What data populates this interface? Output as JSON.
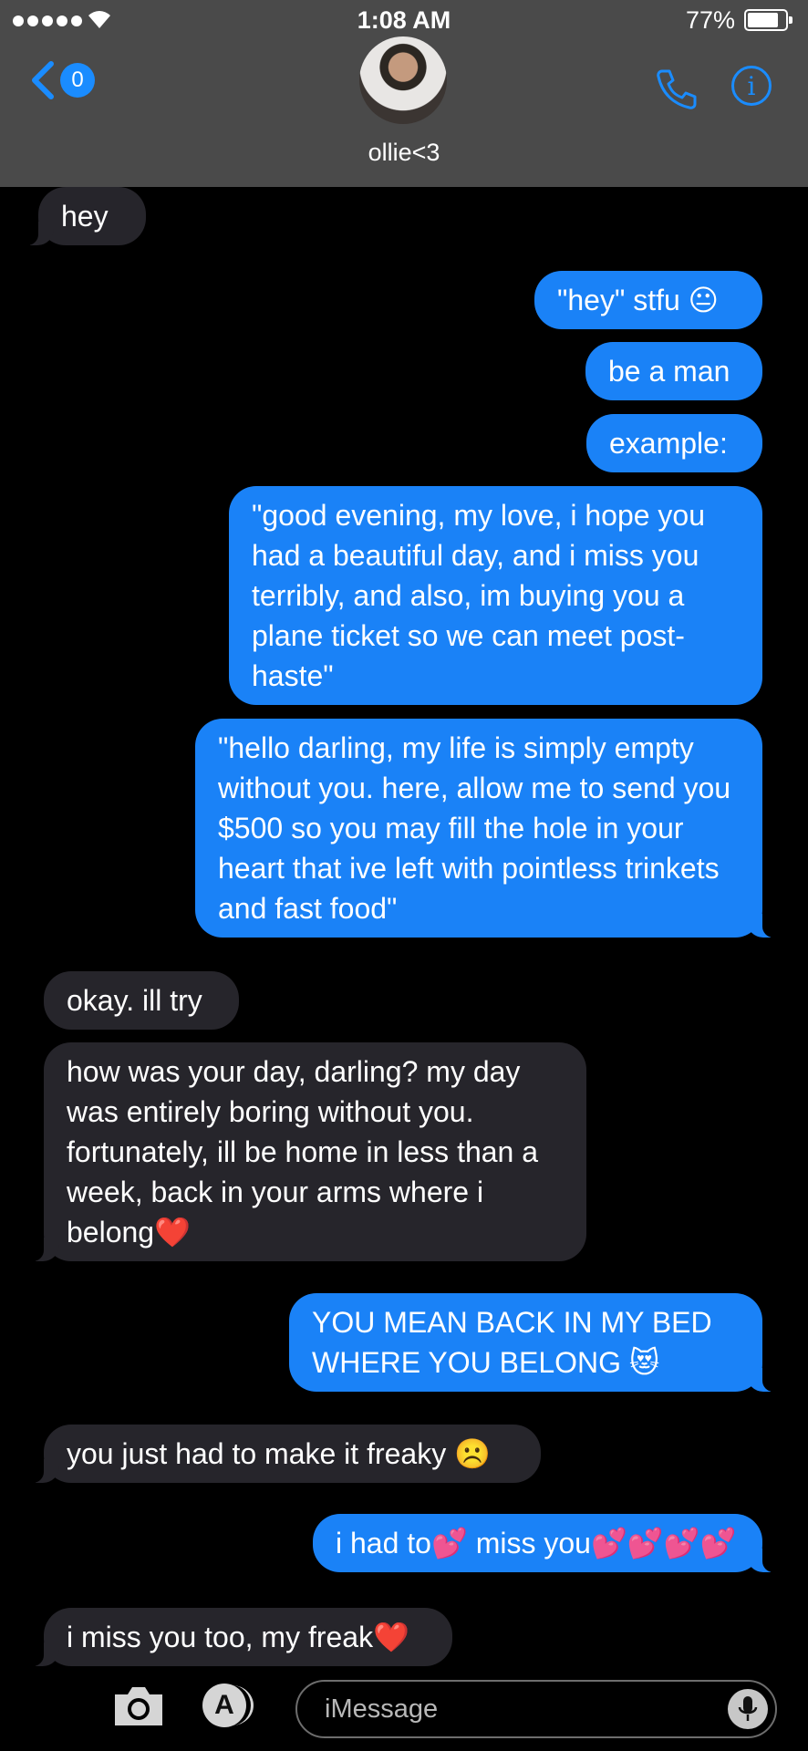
{
  "status_bar": {
    "time": "1:08 AM",
    "battery": "77%"
  },
  "header": {
    "back_badge": "0",
    "contact_name": "ollie<3"
  },
  "messages": [
    {
      "dir": "in",
      "text": "hey"
    },
    {
      "dir": "out",
      "text": "\"hey\" stfu 😐"
    },
    {
      "dir": "out",
      "text": "be a man"
    },
    {
      "dir": "out",
      "text": "example:"
    },
    {
      "dir": "out",
      "text": "\"good evening, my love, i hope you had a beautiful day, and i miss you terribly, and also, im buying you a plane ticket so we can meet post-haste\""
    },
    {
      "dir": "out",
      "text": "\"hello darling, my life is simply empty without you. here, allow me to send you $500 so you may fill the hole in your heart that ive left with pointless trinkets and fast food\""
    },
    {
      "dir": "in",
      "text": "okay. ill try"
    },
    {
      "dir": "in",
      "text": "how was your day, darling? my day was entirely boring without you. fortunately, ill be home in less than a week, back in your arms where i belong❤️"
    },
    {
      "dir": "out",
      "text": "YOU MEAN BACK IN MY BED WHERE YOU BELONG 😻"
    },
    {
      "dir": "in",
      "text": "you just had to make it freaky ☹️"
    },
    {
      "dir": "out",
      "text": "i had to💕 miss you💕💕💕💕"
    },
    {
      "dir": "in",
      "text": "i miss you too, my freak❤️"
    }
  ],
  "input_bar": {
    "placeholder": "iMessage"
  },
  "colors": {
    "incoming": "#26252b",
    "outgoing": "#1a82f7",
    "header": "#4a4a4a",
    "accent": "#1a8cff"
  }
}
